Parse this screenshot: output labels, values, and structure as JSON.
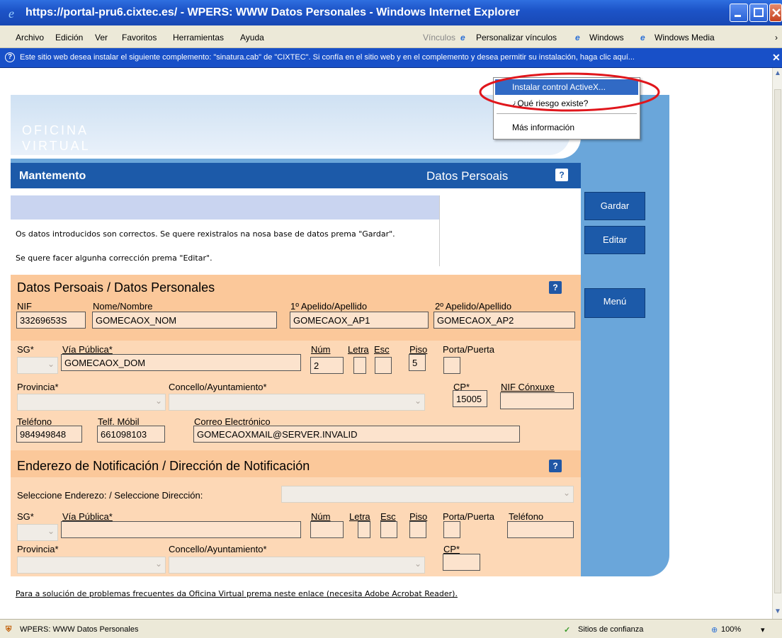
{
  "window": {
    "title": "https://portal-pru6.cixtec.es/ - WPERS: WWW Datos Personales - Windows Internet Explorer"
  },
  "menu": {
    "items": [
      "Archivo",
      "Edición",
      "Ver",
      "Favoritos",
      "Herramientas",
      "Ayuda"
    ],
    "links_label": "Vínculos",
    "link1": "Personalizar vínculos",
    "link2": "Windows",
    "link3": "Windows Media"
  },
  "infobar": {
    "text": "Este sitio web desea instalar el siguiente complemento: \"sinatura.cab\" de \"CIXTEC\". Si confía en el sitio web y en el complemento y desea permitir su instalación, haga clic aquí..."
  },
  "popup": {
    "install": "Instalar control ActiveX...",
    "risk": "¿Qué riesgo existe?",
    "more": "Más información"
  },
  "logo": {
    "line1": "OFICINA",
    "line2": "VIRTUAL"
  },
  "header": {
    "title": "Mantemento",
    "section": "Datos Persoais"
  },
  "message": {
    "line1": "Os datos introducidos son correctos. Se quere rexistralos na nosa base de datos prema \"Gardar\".",
    "line2": "Se quere facer algunha corrección prema \"Editar\"."
  },
  "buttons": {
    "save": "Gardar",
    "edit": "Editar",
    "menu": "Menú"
  },
  "personal": {
    "title": "Datos Persoais / Datos Personales",
    "nif_label": "NIF",
    "nif": "33269653S",
    "nome_label": "Nome/Nombre",
    "nome": "GOMECAOX_NOM",
    "ap1_label": "1º Apelido/Apellido",
    "ap1": "GOMECAOX_AP1",
    "ap2_label": "2º Apelido/Apellido",
    "ap2": "GOMECAOX_AP2",
    "sg_label": "SG*",
    "via_label": "Vía Pública*",
    "via": "GOMECAOX_DOM",
    "num_label": "Núm",
    "num": "2",
    "letra_label": "Letra",
    "esc_label": "Esc",
    "piso_label": "Piso",
    "piso": "5",
    "porta_label": "Porta/Puerta",
    "prov_label": "Provincia*",
    "concello_label": "Concello/Ayuntamiento*",
    "cp_label": "CP*",
    "cp": "15005",
    "nifc_label": "NIF Cónxuxe",
    "tel_label": "Teléfono",
    "tel": "984949848",
    "mov_label": "Telf. Móbil",
    "mov": "661098103",
    "mail_label": "Correo Electrónico",
    "mail": "GOMECAOXMAIL@SERVER.INVALID"
  },
  "notif": {
    "title": "Enderezo de Notificación / Dirección de Notificación",
    "select_label": "Seleccione Enderezo: / Seleccione Dirección:",
    "sg_label": "SG*",
    "via_label": "Vía Pública*",
    "num_label": "Núm",
    "letra_label": "Letra",
    "esc_label": "Esc",
    "piso_label": "Piso",
    "porta_label": "Porta/Puerta",
    "tel_label": "Teléfono",
    "prov_label": "Provincia*",
    "concello_label": "Concello/Ayuntamiento*",
    "cp_label": "CP*"
  },
  "footer": {
    "link": "Para a solución de problemas frecuentes da Oficina Virtual prema neste enlace (necesita Adobe Acrobat Reader)."
  },
  "status": {
    "page": "WPERS: WWW Datos Personales",
    "zone": "Sitios de confianza",
    "zoom": "100%"
  }
}
